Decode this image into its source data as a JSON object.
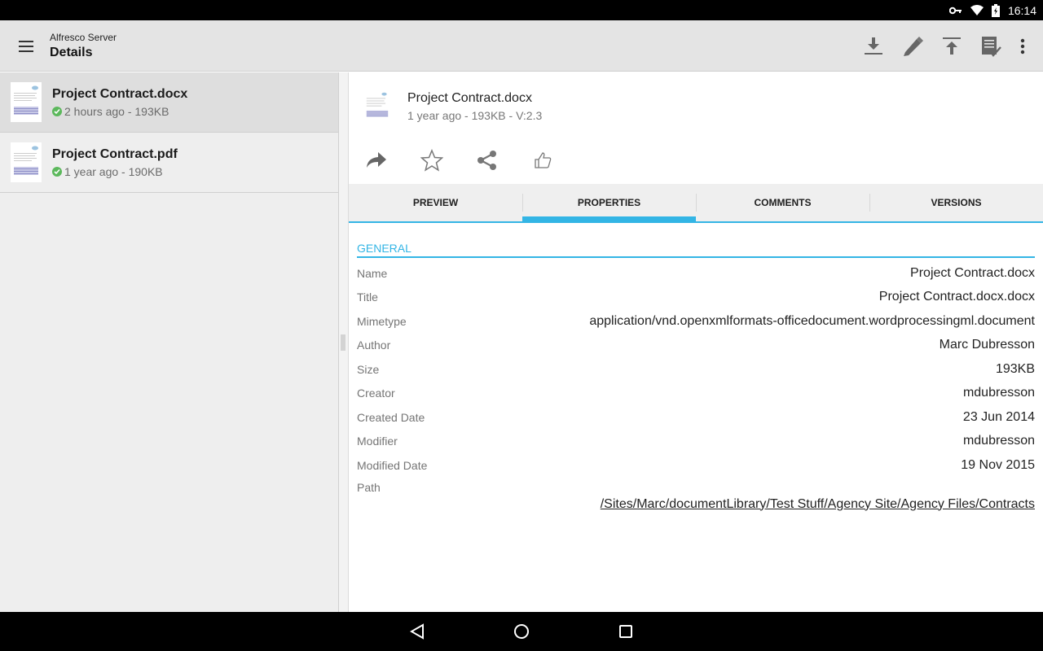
{
  "status_bar": {
    "time": "16:14",
    "icons": [
      "vpn-key-icon",
      "wifi-icon",
      "battery-charging-icon"
    ]
  },
  "app_bar": {
    "subtitle": "Alfresco Server",
    "title": "Details",
    "actions": [
      "download-icon",
      "edit-icon",
      "upload-icon",
      "review-icon",
      "more-icon"
    ]
  },
  "file_list": [
    {
      "name": "Project Contract.docx",
      "meta": "2 hours ago - 193KB",
      "synced": true,
      "selected": true
    },
    {
      "name": "Project Contract.pdf",
      "meta": "1 year ago - 190KB",
      "synced": true,
      "selected": false
    }
  ],
  "document": {
    "name": "Project Contract.docx",
    "meta": "1 year ago - 193KB - V:2.3",
    "actions": [
      "open-with-icon",
      "favorite-icon",
      "share-icon",
      "like-icon"
    ]
  },
  "tabs": [
    {
      "label": "PREVIEW",
      "active": false
    },
    {
      "label": "PROPERTIES",
      "active": true
    },
    {
      "label": "COMMENTS",
      "active": false
    },
    {
      "label": "VERSIONS",
      "active": false
    }
  ],
  "properties": {
    "section": "GENERAL",
    "rows": [
      {
        "label": "Name",
        "value": "Project Contract.docx"
      },
      {
        "label": "Title",
        "value": "Project Contract.docx.docx"
      },
      {
        "label": "Mimetype",
        "value": "application/vnd.openxmlformats-officedocument.wordprocessingml.document"
      },
      {
        "label": "Author",
        "value": "Marc Dubresson"
      },
      {
        "label": "Size",
        "value": "193KB"
      },
      {
        "label": "Creator",
        "value": "mdubresson"
      },
      {
        "label": "Created Date",
        "value": "23 Jun 2014"
      },
      {
        "label": "Modifier",
        "value": "mdubresson"
      },
      {
        "label": "Modified Date",
        "value": "19 Nov 2015"
      }
    ],
    "path": {
      "label": "Path",
      "value": "/Sites/Marc/documentLibrary/Test Stuff/Agency Site/Agency Files/Contracts"
    }
  },
  "colors": {
    "accent": "#33b5e5",
    "synced": "#5cb85c"
  }
}
